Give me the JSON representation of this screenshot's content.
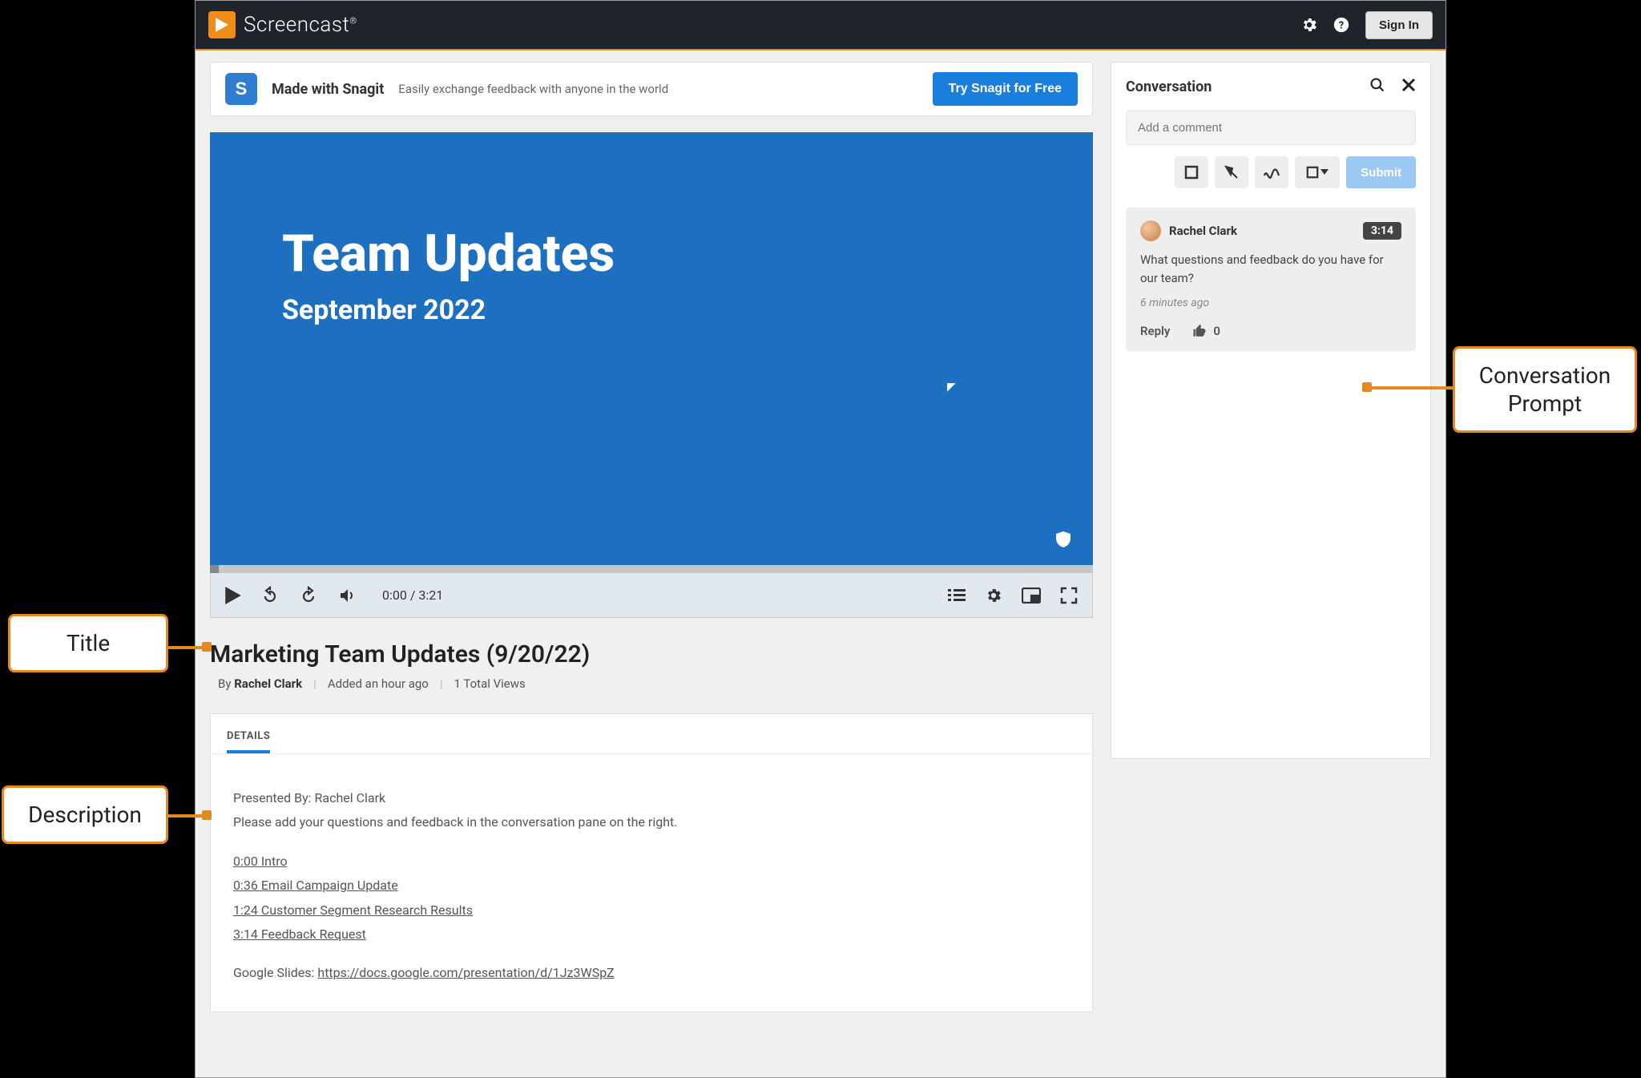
{
  "header": {
    "brand": "Screencast",
    "brand_reg": "®",
    "sign_in": "Sign In"
  },
  "promo": {
    "brand_initial": "S",
    "title": "Made with Snagit",
    "subtitle": "Easily exchange feedback with anyone in the world",
    "cta": "Try Snagit for Free"
  },
  "video": {
    "slide_title": "Team Updates",
    "slide_subtitle": "September 2022",
    "time_display": "0:00 / 3:21"
  },
  "meta": {
    "title": "Marketing Team Updates (9/20/22)",
    "by_prefix": "By",
    "author": "Rachel Clark",
    "added": "Added an hour ago",
    "views": "1 Total Views"
  },
  "details": {
    "tab_label": "DETAILS",
    "presented_by": "Presented By: Rachel Clark",
    "prompt": "Please add your questions and feedback in the conversation pane on the right.",
    "chapters": [
      "0:00 Intro",
      "0:36 Email Campaign Update",
      "1:24 Customer Segment Research Results",
      "3:14 Feedback Request"
    ],
    "slides_label": "Google Slides:",
    "slides_link": "https://docs.google.com/presentation/d/1Jz3WSpZ"
  },
  "conversation": {
    "heading": "Conversation",
    "placeholder": "Add a comment",
    "submit": "Submit",
    "comment": {
      "author": "Rachel Clark",
      "timestamp_badge": "3:14",
      "text": "What questions and feedback do you have for our team?",
      "posted": "6 minutes ago",
      "reply_label": "Reply",
      "like_count": "0"
    }
  },
  "callouts": {
    "title": "Title",
    "description": "Description",
    "conversation_prompt": "Conversation Prompt"
  }
}
